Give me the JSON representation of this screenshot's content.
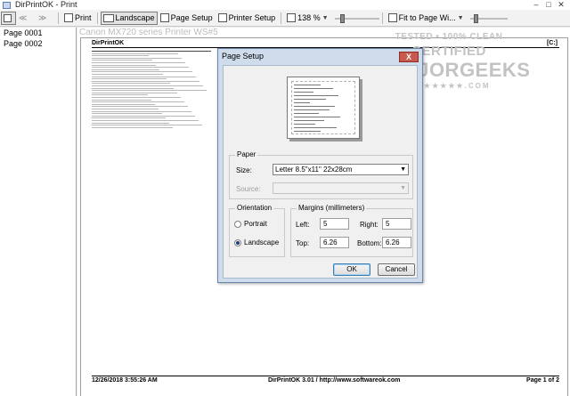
{
  "window": {
    "title": "DirPrintOK - Print",
    "min": "–",
    "max": "□",
    "close": "✕"
  },
  "toolbar": {
    "print_label": "Print",
    "landscape_label": "Landscape",
    "page_setup_label": "Page Setup",
    "printer_setup_label": "Printer Setup",
    "zoom_value": "138 %",
    "fit_label": "Fit to Page Wi..."
  },
  "pages": [
    "Page 0001",
    "Page 0002"
  ],
  "preview": {
    "printer_name": "Canon MX720 series Printer WS#5",
    "header_left": "DirPrintOK",
    "header_right": "[C:]",
    "footer_left": "12/26/2018  3:55:26 AM",
    "footer_mid": "DirPrintOK  3.01 / http://www.softwareok.com",
    "footer_right": "Page 1 of 2"
  },
  "watermark": {
    "line1": "TESTED • 100% CLEAN",
    "line2": "CERTIFIED",
    "line3": "MAJORGEEKS",
    "line4": "★★★★★★★.COM"
  },
  "dialog": {
    "title": "Page Setup",
    "close": "X",
    "paper_group": "Paper",
    "size_label": "Size:",
    "size_value": "Letter 8.5\"x11\" 22x28cm",
    "source_label": "Source:",
    "source_value": "",
    "orientation_group": "Orientation",
    "portrait_label": "Portrait",
    "landscape_label": "Landscape",
    "margins_group": "Margins (millimeters)",
    "left_label": "Left:",
    "left_value": "5",
    "right_label": "Right:",
    "right_value": "5",
    "top_label": "Top:",
    "top_value": "6.26",
    "bottom_label": "Bottom:",
    "bottom_value": "6.26",
    "ok_label": "OK",
    "cancel_label": "Cancel",
    "selected_orientation": "landscape"
  }
}
